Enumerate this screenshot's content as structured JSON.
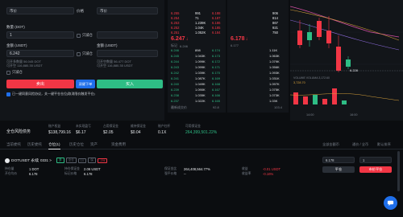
{
  "order_form": {
    "top_left_label": "市价",
    "top_mid_label": "价格",
    "top_right_label": "市价",
    "qty_label": "数量 (DOT)",
    "qty_value": "1",
    "reduce_only_1": "只减仓",
    "amount_label": "金额 (USDT)",
    "amount_label_right": "金额 (USDT)",
    "amount_value": "6.242",
    "reduce_only_2": "只减仓",
    "avail_label_l1": "可开多数量 56.045 DOT",
    "avail_label_l2": "可开空 116,880.35 USDT",
    "avail_label_r1": "可开空数量 56.477 DOT",
    "avail_label_r2": "可开空 116,880.35 USDT",
    "post_only": "只减仓",
    "sell_button": "卖出",
    "double_button": "双键下单",
    "buy_button": "买入",
    "agree_text": "已一键同意风险协议，关一键平仓仓位(取消限价触发平仓)"
  },
  "orderbook_left": {
    "asks": [
      {
        "price": "6.255",
        "qty": "991",
        "total": "6.188"
      },
      {
        "price": "6.254",
        "qty": "71",
        "total": "6.187"
      },
      {
        "price": "6.253",
        "qty": "1.239K",
        "total": "6.186"
      },
      {
        "price": "6.252",
        "qty": "1.04K",
        "total": "6.185"
      },
      {
        "price": "6.251",
        "qty": "1.052K",
        "total": "6.184"
      }
    ],
    "last_price": "6.247",
    "last_arrow": "↓",
    "mark_label": "标记",
    "mark_value": "6.246",
    "bids": [
      {
        "price": "6.246",
        "qty": "898",
        "total": "6.174"
      },
      {
        "price": "6.245",
        "qty": "1.043K",
        "total": "6.173"
      },
      {
        "price": "6.244",
        "qty": "1.099K",
        "total": "6.172"
      },
      {
        "price": "6.243",
        "qty": "1.099K",
        "total": "6.171"
      },
      {
        "price": "6.242",
        "qty": "1.039K",
        "total": "6.170"
      },
      {
        "price": "6.241",
        "qty": "1.087K",
        "total": "6.169"
      },
      {
        "price": "6.240",
        "qty": "1.049K",
        "total": "6.168"
      },
      {
        "price": "6.239",
        "qty": "1.090K",
        "total": "6.167"
      },
      {
        "price": "6.238",
        "qty": "1.035K",
        "total": "6.166"
      },
      {
        "price": "6.237",
        "qty": "1.022K",
        "total": "6.165"
      }
    ],
    "footer_label": "最新成交价",
    "footer_value": "92.8"
  },
  "orderbook_right": {
    "asks_qty": [
      "906",
      "814",
      "867",
      "921",
      "750"
    ],
    "last_price": "6.178",
    "last_arrow": "↓",
    "mark_value": "6.177",
    "bids_qty": [
      "1.11K",
      "1.063K",
      "1.079K",
      "1.056K",
      "1.093K",
      "1.031K",
      "1.097K",
      "1.075K",
      "1.073K",
      "1.03K"
    ],
    "footer_value": "103.4"
  },
  "chart": {
    "price_tag": "6.228",
    "low_tag": "5.936",
    "info_line": "VOLUME VOLUMA 3,172.60",
    "vol_value": "3,728.70",
    "x_labels": [
      "14:00",
      "16:00"
    ]
  },
  "account": {
    "title": "全仓风险债务",
    "cols": [
      {
        "label": "账户权益",
        "value": "$138,799.16"
      },
      {
        "label": "未实现盈亏",
        "value": "$6.17"
      },
      {
        "label": "占用保证金",
        "value": "$2.05"
      },
      {
        "label": "维持保证金",
        "value": "$0.04"
      },
      {
        "label": "账户杠杆",
        "value": "0.1X"
      },
      {
        "label": "可用保证金",
        "value": "264,399,501.22%"
      }
    ]
  },
  "tabs": {
    "items": [
      "当前委托",
      "历史委托",
      "仓位(1)",
      "历史仓位",
      "资产",
      "资金费用"
    ],
    "active_index": 2,
    "right_filter_1": "全部金额币",
    "right_filter_2": "通价 / 全币",
    "right_filter_3": "默认排序"
  },
  "position": {
    "symbol": "DOTUSDT 永续",
    "symbol_tag": "0331 >",
    "badges": [
      "多",
      "全仓",
      "1X",
      "保",
      "-1%"
    ],
    "row1_l_label": "持仓量",
    "row1_l_value": "1 DOT",
    "row1_m_label": "持仓保证金",
    "row1_m_value": "2.06 USDT",
    "row1_r_label": "保证金比",
    "row1_r_value": "264,408,564.77%",
    "row1_pl_label": "收益",
    "row1_pl_value": "-0.01 USDT",
    "row2_l_label": "开仓均价",
    "row2_l_value": "6.178",
    "row2_m_label": "标记价格",
    "row2_m_value": "6.178",
    "row2_r_label": "强平价格",
    "row2_r_value": "--",
    "row2_pl_label": "收益率",
    "row2_pl_value": "-0.16%",
    "price_input_value": "6.178",
    "qty_input_value": "1",
    "close_limit_button": "平仓",
    "close_market_button": "市价平仓"
  },
  "colors": {
    "accent_red": "#f23645",
    "accent_green": "#2ebd85",
    "accent_blue": "#1f6feb"
  }
}
